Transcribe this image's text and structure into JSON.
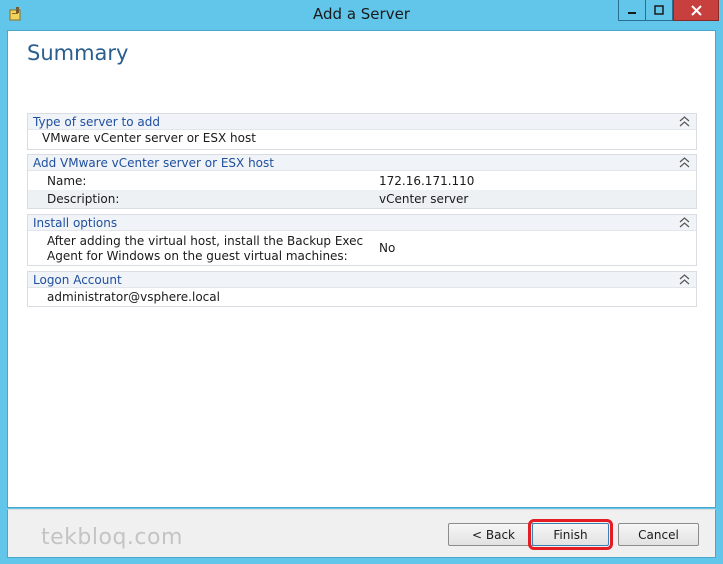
{
  "window": {
    "title": "Add a Server"
  },
  "page": {
    "heading": "Summary"
  },
  "sections": [
    {
      "header": "Type of server to add",
      "rows": [
        {
          "label": "VMware vCenter server or ESX host",
          "value": ""
        }
      ]
    },
    {
      "header": "Add VMware vCenter server or ESX host",
      "rows": [
        {
          "label": "Name:",
          "value": "172.16.171.110"
        },
        {
          "label": "Description:",
          "value": "vCenter server"
        }
      ]
    },
    {
      "header": "Install options",
      "rows": [
        {
          "label_line1": "After adding the virtual host, install the Backup Exec",
          "label_line2": "Agent for Windows on the guest virtual machines:",
          "value": "No"
        }
      ]
    },
    {
      "header": "Logon Account",
      "rows": [
        {
          "label": "administrator@vsphere.local",
          "value": ""
        }
      ]
    }
  ],
  "footer": {
    "watermark": "tekbloq.com",
    "back_label": "< Back",
    "finish_label": "Finish",
    "cancel_label": "Cancel"
  },
  "colors": {
    "titlebar": "#61c6ea",
    "heading": "#2a5e8f",
    "section_header_text": "#1f4f9e",
    "highlight": "#e41c24",
    "close_button": "#c7403d"
  }
}
